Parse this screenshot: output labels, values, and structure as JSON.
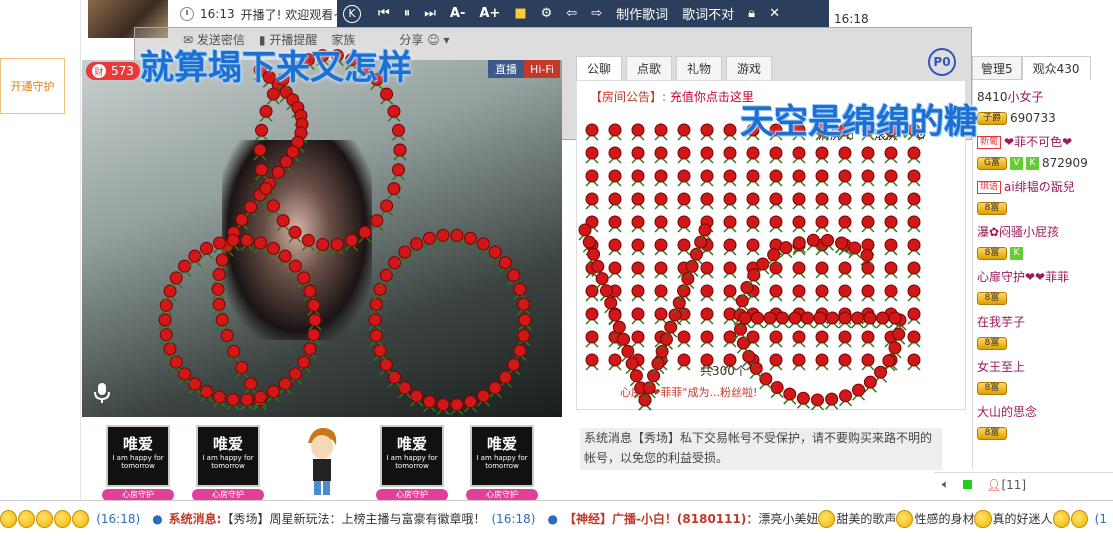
{
  "top": {
    "time": "16:13",
    "welcome": "开播了! 欢迎观看~",
    "right_time": "16:18"
  },
  "actions": {
    "send_secret": "发送密信",
    "live_reminder": "开播提醒",
    "family": "家族",
    "share": "分享"
  },
  "lyrics_bar": {
    "logo": "K",
    "make_lyrics": "制作歌词",
    "wrong_lyrics": "歌词不对",
    "line_left": "就算塌下来又怎样",
    "line_right": "天空是绵绵的糖"
  },
  "left_strip": {
    "label": "开通守护"
  },
  "video": {
    "fan_count": "573",
    "fan_icon": "财",
    "live_label": "直播",
    "hifi_label": "Hi-Fi"
  },
  "guardians": [
    {
      "title": "唯爱",
      "sub": "I am happy for tomorrow",
      "badge": "心房守护"
    },
    {
      "title": "唯爱",
      "sub": "I am happy for tomorrow",
      "badge": "心房守护"
    },
    {
      "title": "唯爱",
      "sub": "I am happy for tomorrow",
      "badge": "心房守护"
    },
    {
      "title": "唯爱",
      "sub": "I am happy for tomorrow",
      "badge": "心房守护"
    }
  ],
  "chat": {
    "tabs": [
      "公聊",
      "点歌",
      "礼物",
      "游戏"
    ],
    "p0": "P0",
    "announce_label": "【房间公告】:",
    "announce_link": "充值你点击这里",
    "clear_screen": "清屏",
    "scroll_screen": "滚屏",
    "gift_count": "共300个",
    "fan_msg": "心房❤❤菲菲\"成为...粉丝啦!",
    "sys_msg_line1": "系统消息【秀场】私下交易帐号不受保护，请不要购买来路不明的",
    "sys_msg_line2": "帐号，以免您的利益受损。"
  },
  "right": {
    "manage_tab": "管理5",
    "viewers_tab": "观众430",
    "viewers": [
      {
        "num": "8410",
        "name": "小女子",
        "badges": []
      },
      {
        "num": "690733",
        "name": "",
        "badges": [
          "子爵"
        ]
      },
      {
        "num": "",
        "name": "❤菲不可色❤",
        "badges": [
          "新葡"
        ]
      },
      {
        "num": "872909",
        "name": "",
        "badges": [
          "G富",
          "V",
          "K"
        ]
      },
      {
        "num": "",
        "name": "ai绯韫の翫兒",
        "badges": [
          "琪语"
        ]
      },
      {
        "num": "",
        "name": "",
        "badges": [
          "8富"
        ]
      },
      {
        "num": "",
        "name": "瀑✿闷骚小屁孩",
        "badges": []
      },
      {
        "num": "",
        "name": "",
        "badges": [
          "8富",
          "K"
        ]
      },
      {
        "num": "",
        "name": "心扉守护❤❤菲菲",
        "badges": []
      },
      {
        "num": "",
        "name": "",
        "badges": [
          "8富"
        ]
      },
      {
        "num": "",
        "name": "在我芋子",
        "badges": []
      },
      {
        "num": "",
        "name": "",
        "badges": [
          "8富"
        ]
      },
      {
        "num": "",
        "name": "女王至上",
        "badges": []
      },
      {
        "num": "",
        "name": "",
        "badges": [
          "8富"
        ]
      },
      {
        "num": "",
        "name": "大山的思念",
        "badges": []
      },
      {
        "num": "",
        "name": "",
        "badges": [
          "8富"
        ]
      }
    ],
    "online_count": "[11]"
  },
  "ticker": {
    "time1": "(16:18)",
    "sys_label": "系统消息:",
    "sys_text": "【秀场】周星新玩法：上榜主播与富豪有徽章哦！",
    "time2": "(16:18)",
    "bc_label": "【神经】广播-小白！(8180111)：",
    "bc_text1": "漂亮小美妞",
    "bc_text2": "甜美的歌声",
    "bc_text3": "性感的身材",
    "bc_text4": "真的好迷人",
    "time3": "(1"
  },
  "colors": {
    "accent": "#e83a3a",
    "lyrics_blue": "#1e6fcf",
    "bar": "#2b3f5c",
    "rose": "#d01818"
  }
}
